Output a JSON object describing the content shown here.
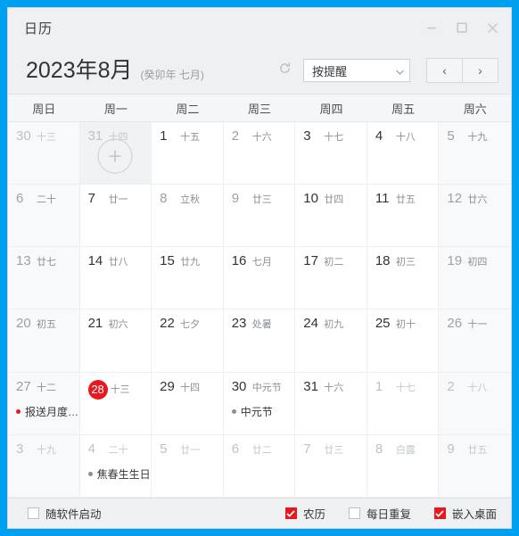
{
  "window": {
    "title": "日历",
    "controls": [
      {
        "name": "minimize-button",
        "icon": "minimize-icon"
      },
      {
        "name": "maximize-button",
        "icon": "maximize-icon"
      },
      {
        "name": "close-button",
        "icon": "close-icon"
      }
    ]
  },
  "toolbar": {
    "month_title": "2023年8月",
    "lunar_title": "(癸卯年 七月)",
    "refresh_icon": "refresh-icon",
    "filter_value": "按提醒",
    "prev_label": "‹",
    "next_label": "›"
  },
  "calendar": {
    "weekdays": [
      "周日",
      "周一",
      "周二",
      "周三",
      "周四",
      "周五",
      "周六"
    ],
    "today_accent": "#e8191e",
    "weeks": [
      [
        {
          "day": "30",
          "lunar": "十三",
          "state": "out"
        },
        {
          "day": "31",
          "lunar": "十四",
          "state": "out",
          "hover": true,
          "add_button": true
        },
        {
          "day": "1",
          "lunar": "十五",
          "state": "normal"
        },
        {
          "day": "2",
          "lunar": "十六",
          "state": "dim"
        },
        {
          "day": "3",
          "lunar": "十七",
          "state": "normal"
        },
        {
          "day": "4",
          "lunar": "十八",
          "state": "normal"
        },
        {
          "day": "5",
          "lunar": "十九",
          "state": "dim"
        }
      ],
      [
        {
          "day": "6",
          "lunar": "二十",
          "state": "dim"
        },
        {
          "day": "7",
          "lunar": "廿一",
          "state": "normal"
        },
        {
          "day": "8",
          "lunar": "立秋",
          "state": "dim"
        },
        {
          "day": "9",
          "lunar": "廿三",
          "state": "dim"
        },
        {
          "day": "10",
          "lunar": "廿四",
          "state": "normal"
        },
        {
          "day": "11",
          "lunar": "廿五",
          "state": "normal"
        },
        {
          "day": "12",
          "lunar": "廿六",
          "state": "dim"
        }
      ],
      [
        {
          "day": "13",
          "lunar": "廿七",
          "state": "dim"
        },
        {
          "day": "14",
          "lunar": "廿八",
          "state": "normal"
        },
        {
          "day": "15",
          "lunar": "廿九",
          "state": "normal"
        },
        {
          "day": "16",
          "lunar": "七月",
          "state": "normal"
        },
        {
          "day": "17",
          "lunar": "初二",
          "state": "normal"
        },
        {
          "day": "18",
          "lunar": "初三",
          "state": "normal"
        },
        {
          "day": "19",
          "lunar": "初四",
          "state": "dim"
        }
      ],
      [
        {
          "day": "20",
          "lunar": "初五",
          "state": "dim"
        },
        {
          "day": "21",
          "lunar": "初六",
          "state": "normal"
        },
        {
          "day": "22",
          "lunar": "七夕",
          "state": "normal"
        },
        {
          "day": "23",
          "lunar": "处暑",
          "state": "normal"
        },
        {
          "day": "24",
          "lunar": "初九",
          "state": "normal"
        },
        {
          "day": "25",
          "lunar": "初十",
          "state": "normal"
        },
        {
          "day": "26",
          "lunar": "十一",
          "state": "dim"
        }
      ],
      [
        {
          "day": "27",
          "lunar": "十二",
          "state": "dim",
          "event": {
            "text": "报送月度…",
            "dot_color": "#e8191e"
          }
        },
        {
          "day": "28",
          "lunar": "十三",
          "state": "today"
        },
        {
          "day": "29",
          "lunar": "十四",
          "state": "normal"
        },
        {
          "day": "30",
          "lunar": "中元节",
          "state": "normal",
          "event": {
            "text": "中元节",
            "dot_color": "#8a9096"
          }
        },
        {
          "day": "31",
          "lunar": "十六",
          "state": "normal"
        },
        {
          "day": "1",
          "lunar": "十七",
          "state": "out"
        },
        {
          "day": "2",
          "lunar": "十八",
          "state": "out"
        }
      ],
      [
        {
          "day": "3",
          "lunar": "十九",
          "state": "out"
        },
        {
          "day": "4",
          "lunar": "二十",
          "state": "out",
          "event": {
            "text": "焦春生生日",
            "dot_color": "#8a9096"
          }
        },
        {
          "day": "5",
          "lunar": "廿一",
          "state": "out"
        },
        {
          "day": "6",
          "lunar": "廿二",
          "state": "out"
        },
        {
          "day": "7",
          "lunar": "廿三",
          "state": "out"
        },
        {
          "day": "8",
          "lunar": "白露",
          "state": "out"
        },
        {
          "day": "9",
          "lunar": "廿五",
          "state": "out"
        }
      ]
    ]
  },
  "statusbar": {
    "options": [
      {
        "label": "随软件启动",
        "checked": false,
        "name": "autostart"
      },
      {
        "label": "农历",
        "checked": true,
        "name": "lunar"
      },
      {
        "label": "每日重复",
        "checked": false,
        "name": "daily-repeat"
      },
      {
        "label": "嵌入桌面",
        "checked": true,
        "name": "embed-desktop"
      }
    ],
    "check_color": "#e8191e"
  }
}
